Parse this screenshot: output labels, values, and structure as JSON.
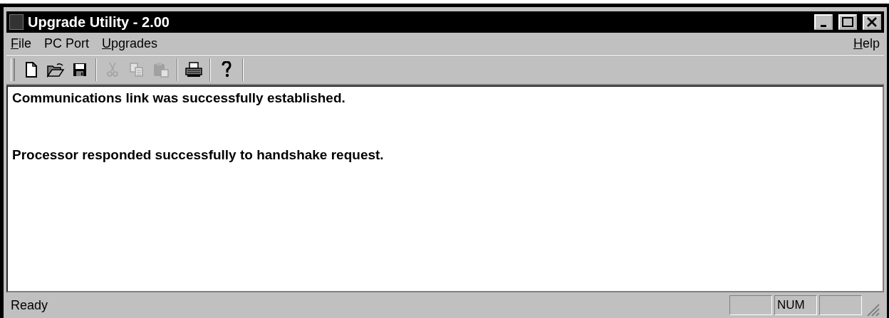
{
  "window": {
    "title": "Upgrade Utility - 2.00"
  },
  "menu": [
    {
      "label": "File",
      "underlined": true
    },
    {
      "label": "PC Port",
      "underlined": false
    },
    {
      "label": "Upgrades",
      "underlined": true
    }
  ],
  "help_menu": {
    "label": "Help",
    "underlined": true
  },
  "toolbar": [
    {
      "kind": "new",
      "disabled": false
    },
    {
      "kind": "open",
      "disabled": false
    },
    {
      "kind": "save",
      "disabled": false
    },
    {
      "kind": "separator"
    },
    {
      "kind": "cut",
      "disabled": true
    },
    {
      "kind": "copy",
      "disabled": true
    },
    {
      "kind": "paste",
      "disabled": true
    },
    {
      "kind": "separator"
    },
    {
      "kind": "print",
      "disabled": false
    },
    {
      "kind": "separator"
    },
    {
      "kind": "help",
      "disabled": false
    },
    {
      "kind": "separator"
    }
  ],
  "messages": [
    "Communications link was successfully established.",
    "Processor responded successfully to handshake request."
  ],
  "status_bar": {
    "text": "Ready",
    "panes": [
      {
        "kind": "empty"
      },
      {
        "kind": "text",
        "label": "NUM"
      },
      {
        "kind": "empty"
      }
    ]
  }
}
